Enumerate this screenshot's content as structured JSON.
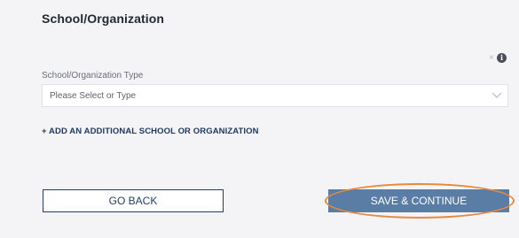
{
  "section": {
    "title": "School/Organization"
  },
  "field": {
    "label": "School/Organization Type",
    "placeholder": "Please Select or Type",
    "clear_glyph": "×",
    "info_glyph": "i"
  },
  "icons": {
    "clear": "close-icon",
    "info": "info-icon",
    "dropdown": "chevron-down-icon"
  },
  "links": {
    "add_additional": "+ ADD AN ADDITIONAL SCHOOL OR ORGANIZATION"
  },
  "buttons": {
    "go_back": "GO BACK",
    "save_continue": "SAVE & CONTINUE"
  },
  "colors": {
    "panel_bg": "#f4f4f6",
    "navy": "#1f3e6d",
    "primary_button": "#5a7da5",
    "highlight": "#e88a3c"
  }
}
